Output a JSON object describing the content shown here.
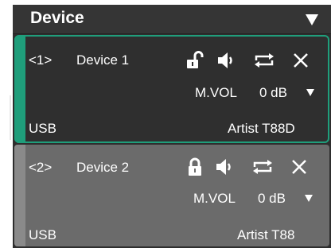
{
  "header": {
    "title": "Device",
    "dropdown_icon": "triangle-down-icon"
  },
  "devices": [
    {
      "index": "<1>",
      "name": "Device 1",
      "lock_state": "unlocked",
      "volume_label": "M.VOL",
      "volume_value": "0 dB",
      "interface": "USB",
      "model": "Artist T88D",
      "selected": true
    },
    {
      "index": "<2>",
      "name": "Device 2",
      "lock_state": "locked",
      "volume_label": "M.VOL",
      "volume_value": "0 dB",
      "interface": "USB",
      "model": "Artist T88",
      "selected": false
    }
  ],
  "colors": {
    "accent": "#1f9e7b",
    "panel": "#2e2e2e",
    "card_inactive": "#6b6b6b"
  }
}
